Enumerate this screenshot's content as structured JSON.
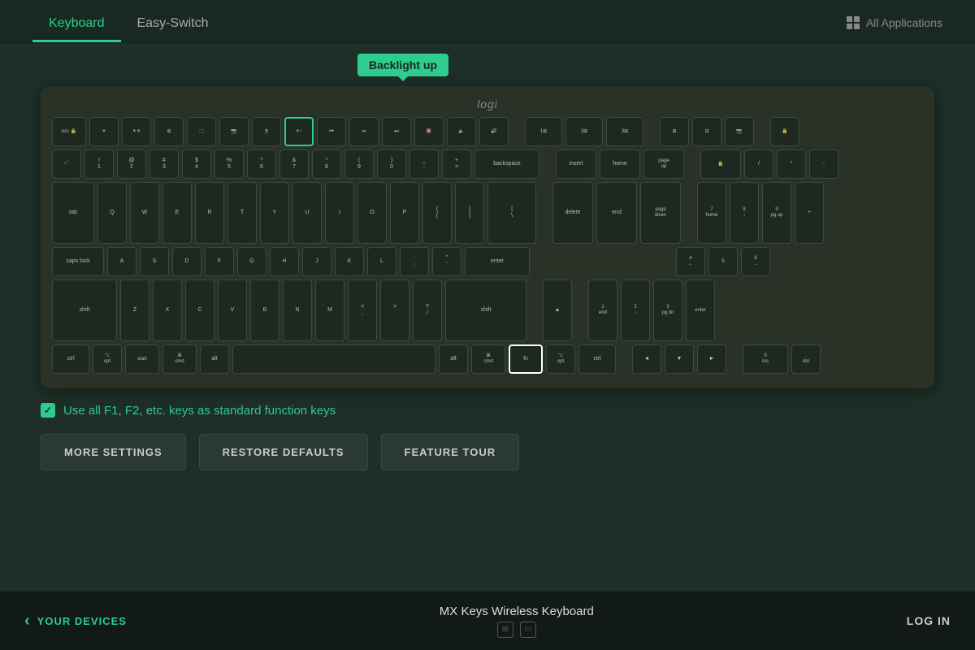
{
  "header": {
    "tab_keyboard": "Keyboard",
    "tab_easyswitch": "Easy-Switch",
    "all_applications": "All Applications"
  },
  "tooltip": {
    "text": "Backlight up"
  },
  "checkbox": {
    "label": "Use all F1, F2, etc. keys as standard function keys",
    "checked": true
  },
  "buttons": {
    "more_settings": "MORE SETTINGS",
    "restore_defaults": "RESTORE DEFAULTS",
    "feature_tour": "FEATURE TOUR"
  },
  "footer": {
    "your_devices": "YOUR DEVICES",
    "device_name": "MX Keys Wireless Keyboard",
    "log_in": "LOG IN"
  },
  "keyboard": {
    "logo": "logi"
  }
}
